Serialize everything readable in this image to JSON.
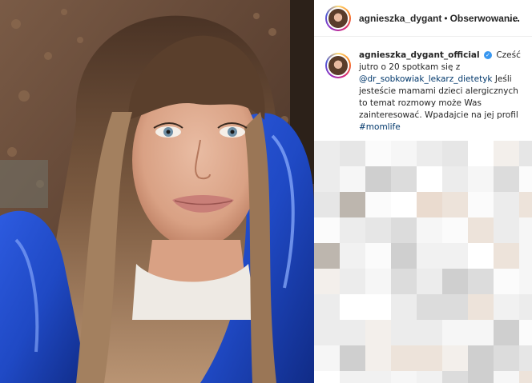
{
  "header": {
    "username": "agnieszka_dygant",
    "separator": "•",
    "follow_label": "Obserwowanie",
    "more_icon": "more-horizontal-icon",
    "more_label": "..."
  },
  "caption": {
    "username": "agnieszka_dygant_official",
    "verified_icon": "verified-badge-icon",
    "verified_mark": "✓",
    "text_1": "Cześć jutro o 20 spotkam się z",
    "mention": "@dr_sobkowiak_lekarz_dietetyk",
    "text_2": "Jeśli jesteście mamami dzieci alergicznych to temat rozmowy może Was zainteresować. Wpadajcie na jej profil",
    "hashtag": "#momlife"
  },
  "colors": {
    "accent": "#3897f0",
    "link": "#00376b",
    "jacket": "#1f49c4",
    "text": "#262626"
  }
}
